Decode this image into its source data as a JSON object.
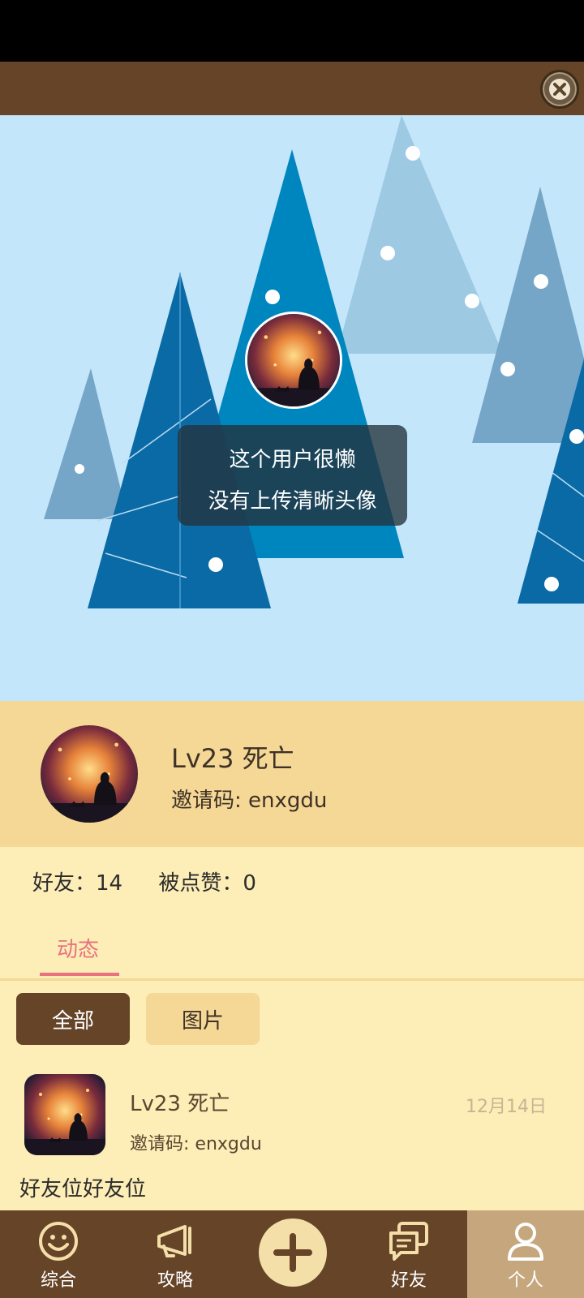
{
  "hero": {
    "lazy_tip_line1": "这个用户很懒",
    "lazy_tip_line2": "没有上传清晰头像"
  },
  "profile": {
    "name": "Lv23 死亡",
    "invite_code": "邀请码: enxgdu"
  },
  "stats": {
    "friends": "好友：14",
    "likes": "被点赞：0"
  },
  "tabs": [
    {
      "label": "动态",
      "active": true
    }
  ],
  "filters": [
    {
      "label": "全部",
      "selected": true
    },
    {
      "label": "图片",
      "selected": false
    }
  ],
  "post": {
    "name": "Lv23 死亡",
    "invite_code": "邀请码: enxgdu",
    "date": "12月14日",
    "text": "好友位好友位"
  },
  "bottom_nav": [
    {
      "label": "综合",
      "icon": "smiley-icon"
    },
    {
      "label": "攻略",
      "icon": "megaphone-icon"
    },
    {
      "label": "",
      "icon": "plus-icon"
    },
    {
      "label": "好友",
      "icon": "chat-icon"
    },
    {
      "label": "个人",
      "icon": "person-icon",
      "active": true
    }
  ],
  "colors": {
    "topbar": "#654428",
    "hero_sky": "#c4e6fb",
    "card": "#f5d796",
    "page_bg": "#fdedb7",
    "tab_active": "#e9727f",
    "nav_active": "#c6a77d"
  }
}
